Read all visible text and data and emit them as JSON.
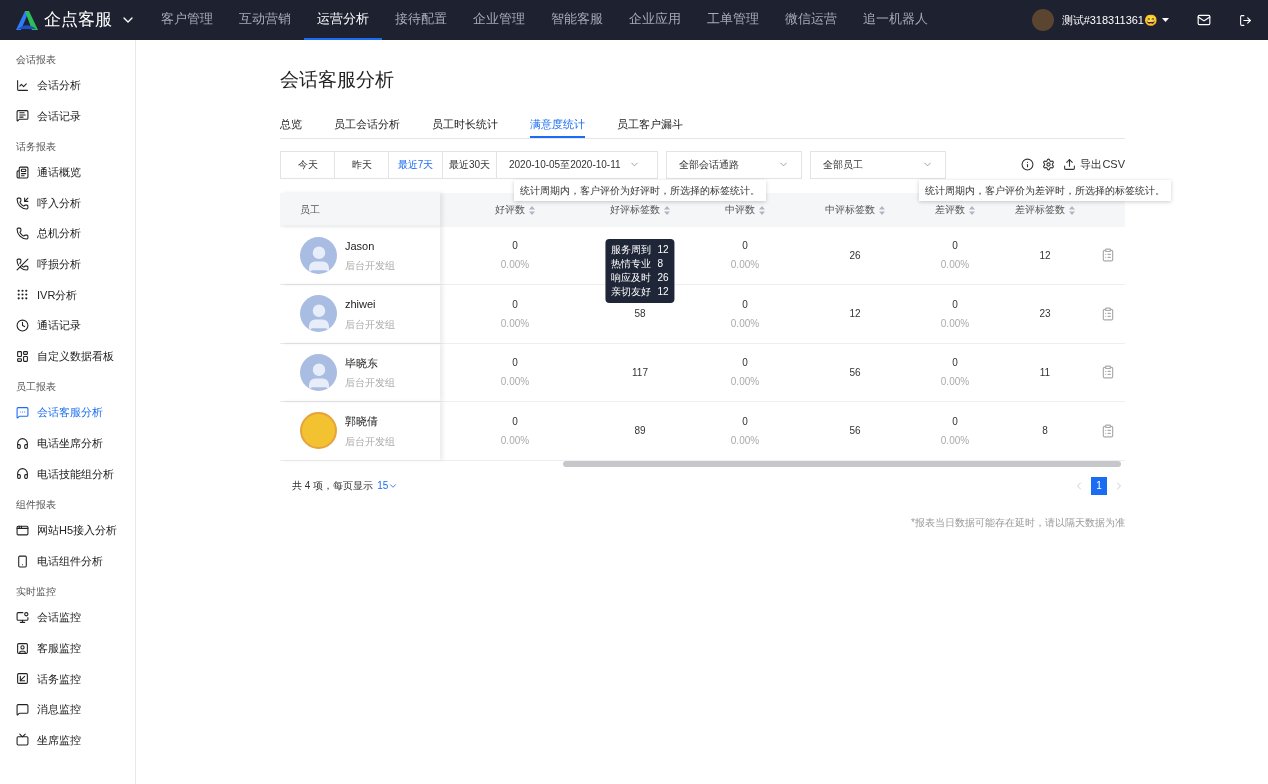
{
  "topbar": {
    "brand": "企点客服",
    "nav": [
      {
        "label": "客户管理",
        "selected": false
      },
      {
        "label": "互动营销",
        "selected": false
      },
      {
        "label": "运营分析",
        "selected": true
      },
      {
        "label": "接待配置",
        "selected": false
      },
      {
        "label": "企业管理",
        "selected": false
      },
      {
        "label": "智能客服",
        "selected": false
      },
      {
        "label": "企业应用",
        "selected": false
      },
      {
        "label": "工单管理",
        "selected": false
      },
      {
        "label": "微信运营",
        "selected": false
      },
      {
        "label": "追一机器人",
        "selected": false
      }
    ],
    "user": "测试#318311361😄"
  },
  "sidebar": [
    {
      "title": "会话报表",
      "items": [
        {
          "label": "会话分析",
          "selected": false
        },
        {
          "label": "会话记录",
          "selected": false
        }
      ]
    },
    {
      "title": "话务报表",
      "items": [
        {
          "label": "通话概览",
          "selected": false
        },
        {
          "label": "呼入分析",
          "selected": false
        },
        {
          "label": "总机分析",
          "selected": false
        },
        {
          "label": "呼损分析",
          "selected": false
        },
        {
          "label": "IVR分析",
          "selected": false
        },
        {
          "label": "通话记录",
          "selected": false
        },
        {
          "label": "自定义数据看板",
          "selected": false
        }
      ]
    },
    {
      "title": "员工报表",
      "items": [
        {
          "label": "会话客服分析",
          "selected": true
        },
        {
          "label": "电话坐席分析",
          "selected": false
        },
        {
          "label": "电话技能组分析",
          "selected": false
        }
      ]
    },
    {
      "title": "组件报表",
      "items": [
        {
          "label": "网站H5接入分析",
          "selected": false
        },
        {
          "label": "电话组件分析",
          "selected": false
        }
      ]
    },
    {
      "title": "实时监控",
      "items": [
        {
          "label": "会话监控",
          "selected": false
        },
        {
          "label": "客服监控",
          "selected": false
        },
        {
          "label": "话务监控",
          "selected": false
        },
        {
          "label": "消息监控",
          "selected": false
        },
        {
          "label": "坐席监控",
          "selected": false
        }
      ]
    }
  ],
  "page_title": "会话客服分析",
  "tabs": [
    {
      "label": "总览",
      "selected": false
    },
    {
      "label": "员工会话分析",
      "selected": false
    },
    {
      "label": "员工时长统计",
      "selected": false
    },
    {
      "label": "满意度统计",
      "selected": true
    },
    {
      "label": "员工客户漏斗",
      "selected": false
    }
  ],
  "filters": {
    "quick_dates": [
      {
        "label": "今天",
        "selected": false
      },
      {
        "label": "昨天",
        "selected": false
      },
      {
        "label": "最近7天",
        "selected": true
      },
      {
        "label": "最近30天",
        "selected": false
      }
    ],
    "date_range": "2020-10-05至2020-10-11",
    "channel": "全部会话通路",
    "staff": "全部员工",
    "export": "导出CSV"
  },
  "table": {
    "columns": [
      {
        "label": "员工"
      },
      {
        "label": "好评数"
      },
      {
        "label": "好评标签数",
        "tooltip": "统计周期内，客户评价为好评时，所选择的标签统计。"
      },
      {
        "label": "中评数"
      },
      {
        "label": "中评标签数"
      },
      {
        "label": "差评数"
      },
      {
        "label": "差评标签数",
        "tooltip": "统计周期内，客户评价为差评时，所选择的标签统计。"
      }
    ],
    "rows": [
      {
        "name": "Jason",
        "group": "后台开发组",
        "kind": "default",
        "good": "0",
        "good_pct": "0.00%",
        "mid": "0",
        "mid_pct": "0.00%",
        "mid_tags": "26",
        "bad": "0",
        "bad_pct": "0.00%",
        "bad_tags": "12"
      },
      {
        "name": "zhiwei",
        "group": "后台开发组",
        "kind": "default",
        "good": "0",
        "good_pct": "0.00%",
        "good_tags": "58",
        "tag_tooltip": [
          {
            "tag": "服务周到",
            "count": "12"
          },
          {
            "tag": "热情专业",
            "count": "8"
          },
          {
            "tag": "响应及时",
            "count": "26"
          },
          {
            "tag": "亲切友好",
            "count": "12"
          }
        ],
        "mid": "0",
        "mid_pct": "0.00%",
        "mid_tags": "12",
        "bad": "0",
        "bad_pct": "0.00%",
        "bad_tags": "23"
      },
      {
        "name": "毕晓东",
        "group": "后台开发组",
        "kind": "default",
        "good": "0",
        "good_pct": "0.00%",
        "good_tags": "117",
        "mid": "0",
        "mid_pct": "0.00%",
        "mid_tags": "56",
        "bad": "0",
        "bad_pct": "0.00%",
        "bad_tags": "11"
      },
      {
        "name": "郭晓倩",
        "group": "后台开发组",
        "kind": "cartoon",
        "good": "0",
        "good_pct": "0.00%",
        "good_tags": "89",
        "mid": "0",
        "mid_pct": "0.00%",
        "mid_tags": "56",
        "bad": "0",
        "bad_pct": "0.00%",
        "bad_tags": "8"
      }
    ]
  },
  "pagination": {
    "summary": "共 4 项，每页显示",
    "page_size": "15",
    "pages": [
      {
        "label": "1",
        "selected": true
      }
    ]
  },
  "footnote": "*报表当日数据可能存在延时，请以隔天数据为准"
}
